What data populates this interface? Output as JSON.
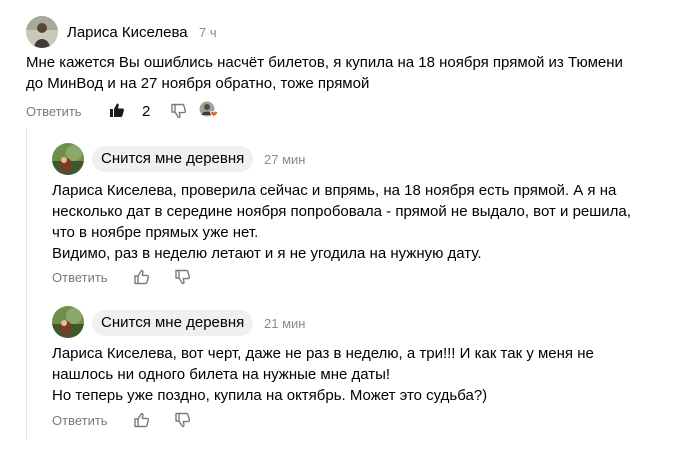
{
  "comments": [
    {
      "author": "Лариса Киселева",
      "time": "7 ч",
      "text": "Мне кажется Вы ошиблись насчёт билетов, я купила на 18 ноября прямой из Тюмени\nдо МинВод и на 27 ноября обратно, тоже прямой",
      "reply_label": "Ответить",
      "likes": "2"
    },
    {
      "author": "Снится мне деревня",
      "time": "27 мин",
      "text": "Лариса Киселева, проверила сейчас и впрямь, на 18 ноября есть прямой. А я на\nнесколько дат в середине ноября попробовала - прямой не выдало, вот и решила,\nчто в ноябре прямых уже нет.\nВидимо, раз в неделю летают и я не угодила на нужную дату.",
      "reply_label": "Ответить"
    },
    {
      "author": "Снится мне деревня",
      "time": "21 мин",
      "text": "Лариса Киселева, вот черт, даже не раз в неделю, а три!!! И как так у меня не\nнашлось ни одного билета на нужные мне даты!\nНо теперь уже поздно, купила на октябрь. Может это судьба?)",
      "reply_label": "Ответить"
    }
  ],
  "icons": {
    "like": "thumbs-up-icon",
    "dislike": "thumbs-down-icon",
    "reactor": "reactor-avatar-icon"
  },
  "colors": {
    "like_active": "#1a1a1a",
    "muted": "#7a7a7a",
    "pill_bg": "#f0f0f0",
    "heart": "#f05a28"
  }
}
